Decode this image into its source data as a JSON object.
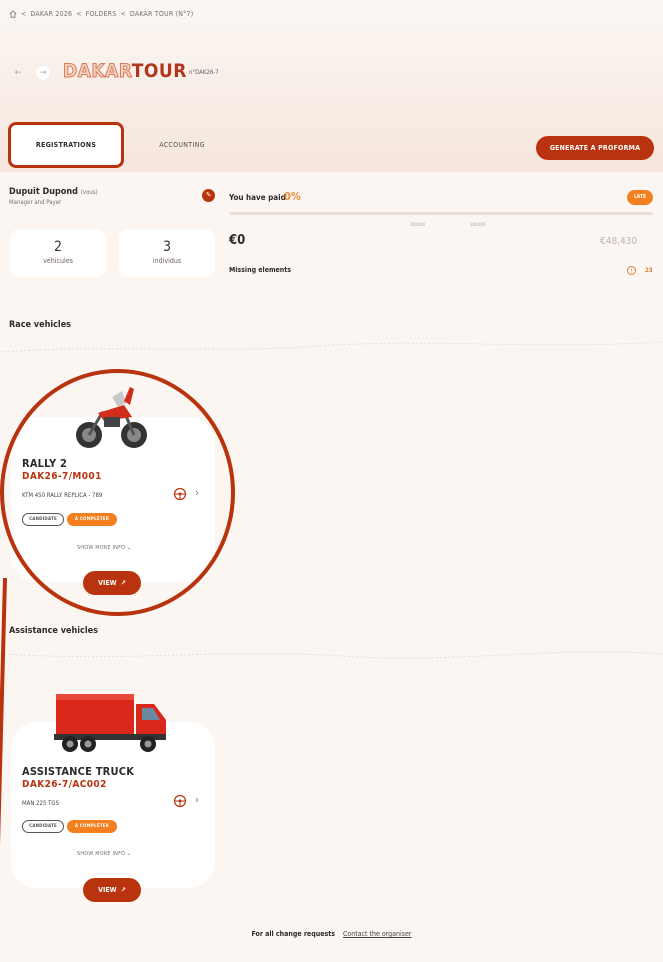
{
  "breadcrumb": {
    "items": [
      "DAKAR 2026",
      "FOLDERS",
      "DAKAR TOUR (N°7)"
    ]
  },
  "header": {
    "title_part1": "DAKAR",
    "title_part2": "TOUR",
    "folder_number": "n°DAK26-7"
  },
  "tabs": [
    {
      "label": "REGISTRATIONS"
    },
    {
      "label": "ACCOUNTING"
    }
  ],
  "actions": {
    "proforma_label": "GENERATE A PROFORMA"
  },
  "user": {
    "name": "Dupuit Dupond",
    "you_tag": "(vous)",
    "role": "Manager and Payer"
  },
  "stats": [
    {
      "value": "2",
      "label": "véhicules"
    },
    {
      "value": "3",
      "label": "individus"
    }
  ],
  "payment": {
    "paid_label": "You have paid",
    "paid_percent": "0%",
    "paid_fraction": 0,
    "status_badge": "LATE",
    "amount_paid": "€0",
    "amount_total": "€48,430",
    "missing_label": "Missing elements",
    "missing_count": "23",
    "markers": [
      "100.000",
      "100.000"
    ]
  },
  "sections": {
    "race": "Race vehicles",
    "assistance": "Assistance vehicles"
  },
  "vehicles": [
    {
      "title": "RALLY 2",
      "id": "DAK26-7/M001",
      "model": "KTM 450 RALLY REPLICA - 789",
      "candidate": "CANDIDATE",
      "status": "À COMPLÉTER",
      "show_more": "SHOW MORE INFO",
      "view": "VIEW"
    },
    {
      "title": "ASSISTANCE TRUCK",
      "id": "DAK26-7/AC002",
      "model": "MAN 225 TGS",
      "candidate": "CANDIDATE",
      "status": "À COMPLÉTER",
      "show_more": "SHOW MORE INFO",
      "view": "VIEW"
    }
  ],
  "footer": {
    "label": "For all change requests",
    "link": "Contact the organiser"
  },
  "colors": {
    "accent": "#b9330f",
    "orange": "#f47f1f",
    "background": "#fbf6f2"
  }
}
